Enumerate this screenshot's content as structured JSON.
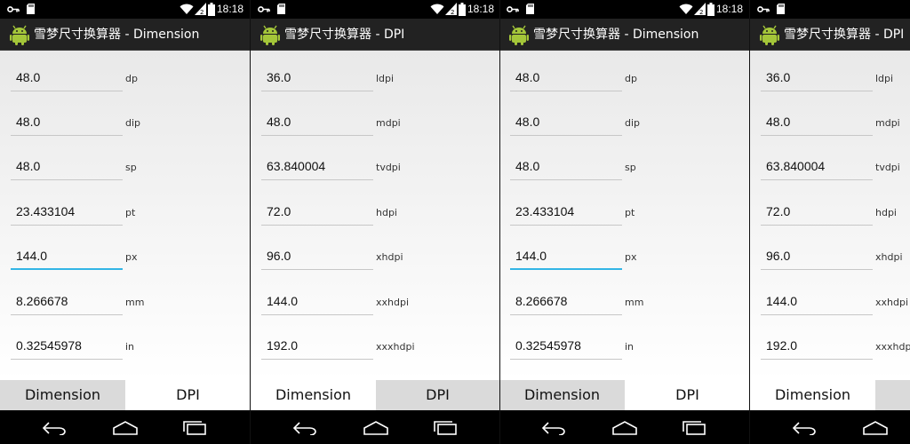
{
  "status_time": "18:18",
  "panels": [
    {
      "title": "雪梦尺寸换算器 - Dimension",
      "fields": [
        {
          "value": "48.0",
          "unit": "dp"
        },
        {
          "value": "48.0",
          "unit": "dip"
        },
        {
          "value": "48.0",
          "unit": "sp"
        },
        {
          "value": "23.433104",
          "unit": "pt"
        },
        {
          "value": "144.0",
          "unit": "px"
        },
        {
          "value": "8.266678",
          "unit": "mm"
        },
        {
          "value": "0.32545978",
          "unit": "in"
        }
      ],
      "tabs": [
        "Dimension",
        "DPI"
      ]
    },
    {
      "title": "雪梦尺寸换算器 - DPI",
      "fields": [
        {
          "value": "36.0",
          "unit": "ldpi"
        },
        {
          "value": "48.0",
          "unit": "mdpi"
        },
        {
          "value": "63.840004",
          "unit": "tvdpi"
        },
        {
          "value": "72.0",
          "unit": "hdpi"
        },
        {
          "value": "96.0",
          "unit": "xhdpi"
        },
        {
          "value": "144.0",
          "unit": "xxhdpi"
        },
        {
          "value": "192.0",
          "unit": "xxxhdpi"
        }
      ],
      "tabs": [
        "Dimension",
        "DPI"
      ]
    },
    {
      "title": "雪梦尺寸换算器 - Dimension",
      "fields": [
        {
          "value": "48.0",
          "unit": "dp"
        },
        {
          "value": "48.0",
          "unit": "dip"
        },
        {
          "value": "48.0",
          "unit": "sp"
        },
        {
          "value": "23.433104",
          "unit": "pt"
        },
        {
          "value": "144.0",
          "unit": "px"
        },
        {
          "value": "8.266678",
          "unit": "mm"
        },
        {
          "value": "0.32545978",
          "unit": "in"
        }
      ],
      "tabs": [
        "Dimension",
        "DPI"
      ]
    },
    {
      "title": "雪梦尺寸换算器 - DPI",
      "fields": [
        {
          "value": "36.0",
          "unit": "ldpi"
        },
        {
          "value": "48.0",
          "unit": "mdpi"
        },
        {
          "value": "63.840004",
          "unit": "tvdpi"
        },
        {
          "value": "72.0",
          "unit": "hdpi"
        },
        {
          "value": "96.0",
          "unit": "xhdpi"
        },
        {
          "value": "144.0",
          "unit": "xxhdpi"
        },
        {
          "value": "192.0",
          "unit": "xxxhdpi"
        }
      ],
      "tabs": [
        "Dimension"
      ]
    }
  ],
  "icons": {
    "key": "key-icon",
    "sd": "sd-card-icon",
    "wifi": "wifi-icon",
    "signal": "signal-icon",
    "battery": "battery-icon",
    "app": "android-app-icon",
    "back": "back-icon",
    "home": "home-icon",
    "recents": "recents-icon"
  },
  "colors": {
    "focus_accent": "#33b5e5",
    "action_bar": "#222222",
    "tab_inactive": "#dadada",
    "tab_active": "#ffffff"
  }
}
